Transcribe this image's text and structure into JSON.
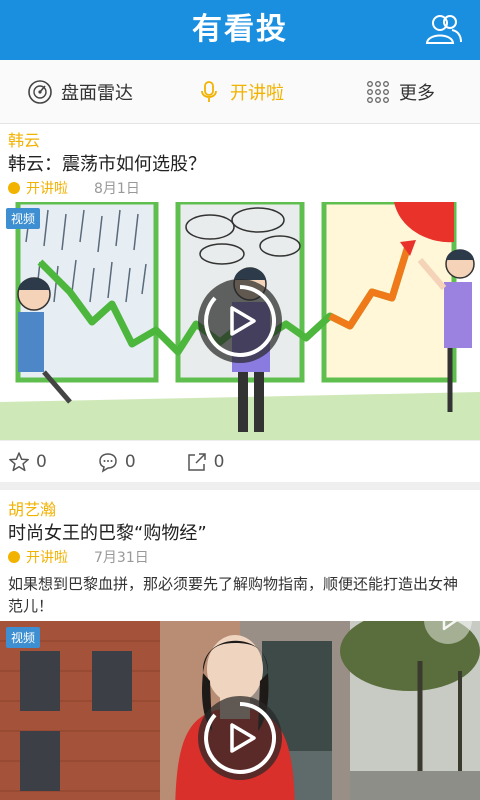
{
  "header": {
    "title": "有看投"
  },
  "tabs": [
    {
      "label": "盘面雷达",
      "active": false
    },
    {
      "label": "开讲啦",
      "active": true
    },
    {
      "label": "更多",
      "active": false
    }
  ],
  "feed": [
    {
      "author": "韩云",
      "title": "韩云：震荡市如何选股？",
      "category": "开讲啦",
      "date": "8月1日",
      "badge": "视频",
      "likes": "0",
      "comments": "0",
      "shares": "0"
    },
    {
      "author": "胡艺瀚",
      "title": "时尚女王的巴黎“购物经”",
      "category": "开讲啦",
      "date": "7月31日",
      "summary": "如果想到巴黎血拼，那必须要先了解购物指南，顺便还能打造出女神范儿！",
      "badge": "视频"
    }
  ],
  "colors": {
    "header": "#1a8fe0",
    "accent": "#f2b200",
    "badge": "#3d8fd1"
  }
}
